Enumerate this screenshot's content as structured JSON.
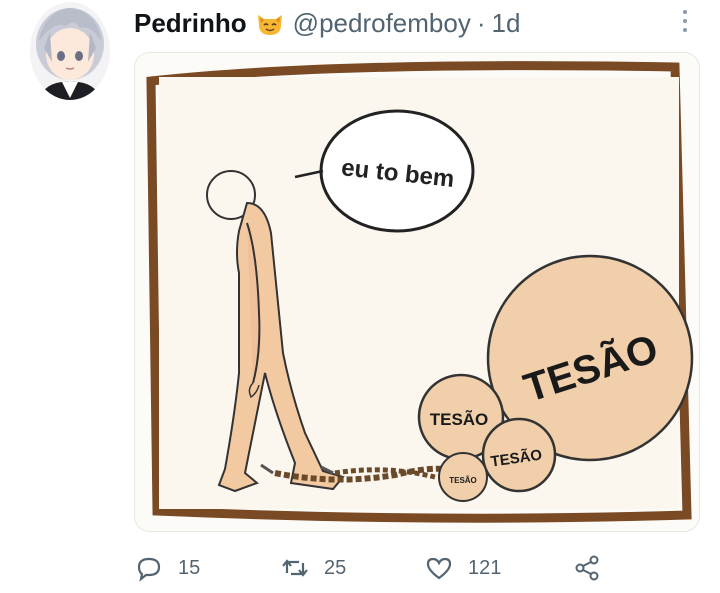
{
  "tweet": {
    "author_name": "Pedrinho",
    "author_emoji": "cat-emoji-icon",
    "handle": "@pedrofemboy",
    "separator": "·",
    "time": "1d"
  },
  "media": {
    "speech_bubble": "eu to bem",
    "balls": [
      "TESÃO",
      "TESÃO",
      "TESÃO",
      "TESÃO"
    ]
  },
  "actions": {
    "replies": "15",
    "retweets": "25",
    "likes": "121",
    "share_icon": "share-icon"
  },
  "colors": {
    "handle_gray": "#536471",
    "frame_brown": "#7a4a25",
    "skin": "#f2c9a0",
    "ball_fill": "#f0cfaa",
    "paper": "#fbf7ef"
  }
}
